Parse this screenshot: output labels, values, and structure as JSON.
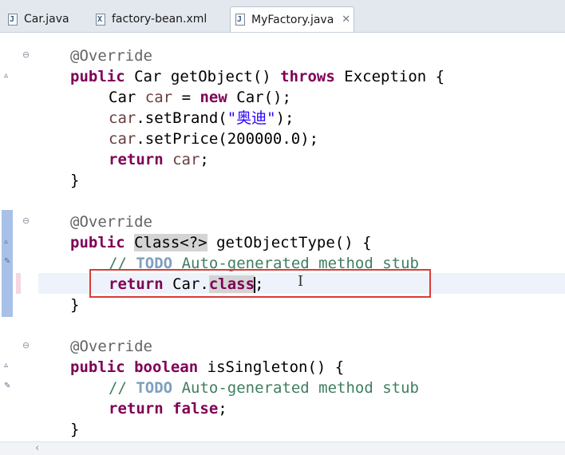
{
  "tabs": [
    {
      "label": "Car.java",
      "icon": "java-file-icon",
      "glyph": "J",
      "active": false
    },
    {
      "label": "factory-bean.xml",
      "icon": "xml-file-icon",
      "glyph": "X",
      "active": false
    },
    {
      "label": "MyFactory.java",
      "icon": "java-file-icon",
      "glyph": "J",
      "active": true,
      "close": "✕"
    }
  ],
  "code": {
    "m1": {
      "annotation": "@Override",
      "sig_kw": "public",
      "sig_type": "Car",
      "sig_name": "getObject()",
      "sig_throws": "throws",
      "sig_exc": "Exception {",
      "l1_type": "Car",
      "l1_var": "car",
      "l1_eq": "=",
      "l1_new": "new",
      "l1_ctor": "Car();",
      "l2_var": "car",
      "l2_call": ".setBrand(",
      "l2_str": "\"奥迪\"",
      "l2_end": ");",
      "l3_var": "car",
      "l3_call": ".setPrice(200000.0);",
      "l4_kw": "return",
      "l4_var": "car",
      "l4_end": ";",
      "close": "}"
    },
    "m2": {
      "annotation": "@Override",
      "sig_kw": "public",
      "sig_type": "Class<?>",
      "sig_name": "getObjectType() {",
      "comment_slash": "//",
      "comment_todo": "TODO",
      "comment_rest": "Auto-generated method stub",
      "ret_kw": "return",
      "ret_expr": "Car.",
      "ret_class": "class",
      "ret_end": ";",
      "close": "}"
    },
    "m3": {
      "annotation": "@Override",
      "sig_kw": "public",
      "sig_type": "boolean",
      "sig_name": "isSingleton() {",
      "comment_slash": "//",
      "comment_todo": "TODO",
      "comment_rest": "Auto-generated method stub",
      "ret_kw": "return",
      "ret_val": "false",
      "ret_end": ";",
      "close": "}"
    }
  },
  "gutter": {
    "fold_symbol": "⊖",
    "override_marker": "▵",
    "task_marker": "✎"
  },
  "colors": {
    "keyword": "#7f0055",
    "string": "#2a00ff",
    "comment": "#3f7f5f",
    "annotation": "#646464",
    "highlight_box": "#d93b3b"
  },
  "scroll_left": "‹"
}
